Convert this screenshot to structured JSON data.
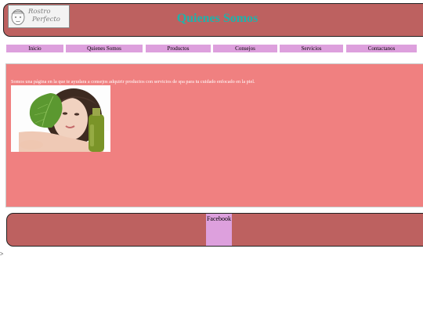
{
  "header": {
    "title": "Quienes Somos",
    "logo": {
      "line1": "Rostro",
      "line2": "Perfecto"
    }
  },
  "nav": {
    "items": [
      {
        "label": "Inicio"
      },
      {
        "label": "Quienes Somos"
      },
      {
        "label": "Productos"
      },
      {
        "label": "Consejos"
      },
      {
        "label": "Servicios"
      },
      {
        "label": "Contactanos"
      }
    ]
  },
  "main": {
    "intro": "Somos una página en la que te ayudara a consejos adquirir productos con servicios de spa para tu cuidado enfocado en la piel."
  },
  "footer": {
    "facebook_label": "Facebook"
  },
  "stray_text": ">",
  "colors": {
    "header_bg": "#bd6160",
    "title": "#20b2aa",
    "nav_bg": "#dda0dd",
    "content_bg": "#f08080"
  }
}
